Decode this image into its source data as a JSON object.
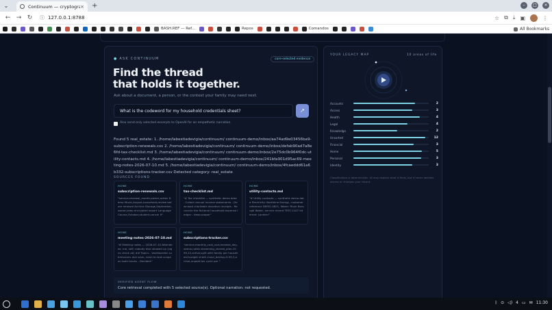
{
  "browser": {
    "tab_title": "Continuum — cryptograph",
    "url": "127.0.0.1:8788",
    "bookmarks": [
      {
        "label": "",
        "color": "#1a1a1a"
      },
      {
        "label": "",
        "color": "#2a2a2a"
      },
      {
        "label": "",
        "color": "#6b57c9"
      },
      {
        "label": "",
        "color": "#555"
      },
      {
        "label": "",
        "color": "#222"
      },
      {
        "label": "",
        "color": "#3c8f4a"
      },
      {
        "label": "",
        "color": "#222"
      },
      {
        "label": "",
        "color": "#c94e3e"
      },
      {
        "label": "",
        "color": "#222"
      },
      {
        "label": "",
        "color": "#0a66c2"
      },
      {
        "label": "",
        "color": "#222"
      },
      {
        "label": "",
        "color": "#222"
      },
      {
        "label": "",
        "color": "#333"
      },
      {
        "label": "",
        "color": "#444"
      },
      {
        "label": "",
        "color": "#222"
      },
      {
        "label": "",
        "color": "#c94e3e"
      },
      {
        "label": "",
        "color": "#222"
      },
      {
        "label": "BASH.REF — Ref...",
        "color": "#555"
      },
      {
        "label": "",
        "color": "#6b57c9"
      },
      {
        "label": "",
        "color": "#c94e3e"
      },
      {
        "label": "",
        "color": "#333"
      },
      {
        "label": "",
        "color": "#222"
      },
      {
        "label": "Repos",
        "color": "#222"
      },
      {
        "label": "",
        "color": "#c94e3e"
      },
      {
        "label": "",
        "color": "#222"
      },
      {
        "label": "",
        "color": "#222"
      },
      {
        "label": "",
        "color": "#222"
      },
      {
        "label": "",
        "color": "#c94e3e"
      },
      {
        "label": "Comandos",
        "color": "#222"
      },
      {
        "label": "",
        "color": "#222"
      },
      {
        "label": "",
        "color": "#222"
      },
      {
        "label": "",
        "color": "#6b57c9"
      },
      {
        "label": "",
        "color": "#c94e3e"
      },
      {
        "label": "",
        "color": "#3a8bd6"
      }
    ],
    "all_bookmarks": "All Bookmarks"
  },
  "ask": {
    "label": "ASK CONTINUUM",
    "badge": "core-selected evidence",
    "hero_line1": "Find the thread",
    "hero_line2": "that holds it together.",
    "subhead": "Ask about a document, a person, or the context your family may need next.",
    "question": "What is the codeword for my household credentials sheet?",
    "send_icon": "↗",
    "narration_label": "Also send only selected excerpts to OpenAI for an empathetic narration."
  },
  "answer": "Found 5 real_estate: 1. /home/labestiadevigia/continuum/ continuum-demo/inbox/aa74ad9e03456ba9-subscription-renewals.csv 2. /home/labestiadevigia/continuum/ continuum-demo/inbox/defab90ad7a8e6fd-tax-checklist.md 3. /home/labestiadevigia/continuum/ continuum-demo/inbox/2e75dc0b964f0dc-utility-contacts.md 4. /home/labestiadevigia/continuum/ continuum-demo/inbox/241bfa901d95ac69-meeting-notes-2026-07-10.md 5. /home/labestiadevigia/continuum/ continuum-demo/inbox/4fcaeddd61a6b332-subscriptions-tracker.csv Detected category: real_estate",
  "sources": {
    "heading": "SOURCES FOUND",
    "items": [
      {
        "kind": "HOME",
        "title": "subscription-renewals.csv",
        "body": "\"service,renewal_month,owner,action Demo Music,August,household,review before renewal Archive Storage,September,owner,keep encrypted export Language Course,October,student,cancel if\""
      },
      {
        "kind": "HOME",
        "title": "tax-checklist.md",
        "body": "\"# Tax checklist — synthetic demo data - Collect annual income statements - Download charitable donation receipts - Reconcile the fictional household expense ledger - Keep proper\""
      },
      {
        "kind": "HOME",
        "title": "utility-contacts.md",
        "body": "\"# Utility contacts — synthetic demo data Electricity: Northline Energy, customer reference DEMO-4821, Water: River Borough Water, service record TEST-1107 Internet: Lantern\""
      },
      {
        "kind": "HOME",
        "title": "meeting-notes-2026-07-10.md",
        "body": "\"# Meeting notes — 2026-07-10 Attendees: me, self; nobody else showed up (signs check ok) ## Topics - Vaultwarden submissions due soon, need to look scope on both tracks - Decided:\""
      },
      {
        "kind": "HOME",
        "title": "subscriptions-tracker.csv",
        "body": "\"service,monthly_cost_usd,renewal_day,status,notes streaming_shared_plan,15.99,12,active,split with family per household budget sheet cloud_backup,9.99,3,active,unpaid tax cycle per \""
      }
    ]
  },
  "flow": {
    "label": "VERIFIED AGENT FLOW",
    "text": "Core retrieval completed with 5 selected source(s). Optional narration: not requested."
  },
  "legacy_map": {
    "title": "YOUR LEGACY MAP",
    "count": "10 areas of life",
    "rows": [
      {
        "name": "Accounts",
        "value": "2",
        "fill": 0.82
      },
      {
        "name": "Access",
        "value": "3",
        "fill": 0.78
      },
      {
        "name": "Health",
        "value": "4",
        "fill": 0.88
      },
      {
        "name": "Legal",
        "value": "4",
        "fill": 0.72
      },
      {
        "name": "Knowledge",
        "value": "2",
        "fill": 0.58
      },
      {
        "name": "Unsorted",
        "value": "12",
        "fill": 0.95
      },
      {
        "name": "Financial",
        "value": "3",
        "fill": 0.8
      },
      {
        "name": "Home",
        "value": "5",
        "fill": 0.91
      },
      {
        "name": "Personal",
        "value": "3",
        "fill": 0.9
      },
      {
        "name": "Identity",
        "value": "3",
        "fill": 0.78
      }
    ],
    "note": "Classification is deterministic. AI may explain what it finds, but it never decides access or changes your record."
  },
  "taskbar": {
    "time": "11:30",
    "battery": "4",
    "icons": [
      "#2f6fd0",
      "#e0b14a",
      "#4aa3df",
      "#7bc6f0",
      "#3a9ad9",
      "#6ac0c7",
      "#a98be0",
      "#888",
      "#4aa0e8",
      "#3c7fd6",
      "#3a74c9",
      "#e07a3a",
      "#2e88d8"
    ]
  }
}
